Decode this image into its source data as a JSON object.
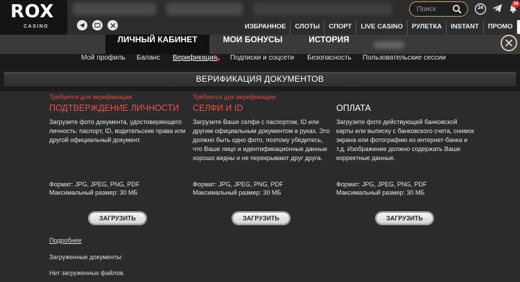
{
  "brand": {
    "logo": "ROX",
    "subtitle": "CASINO"
  },
  "header": {
    "top_nav": [
      "ИЗБРАННОЕ",
      "СЛОТЫ",
      "СПОРТ",
      "LIVE CASINO",
      "РУЛЕТКА",
      "INSTANT",
      "ПРОМО"
    ],
    "search_placeholder": "Поиск",
    "support_label": "24",
    "notification_count": "36",
    "social_icons": [
      "telegram-icon",
      "vk-icon",
      "x-icon"
    ]
  },
  "tabs": [
    "ЛИЧНЫЙ КАБИНЕТ",
    "МОИ БОНУСЫ",
    "ИСТОРИЯ"
  ],
  "subnav": [
    "Мой профиль",
    "Баланс",
    "Верификация",
    "Подписки и соцсети",
    "Безопасность",
    "Пользовательские сессии"
  ],
  "page_title": "ВЕРИФИКАЦИЯ ДОКУМЕНТОВ",
  "columns": [
    {
      "required": "Требуется для верификации",
      "title": "ПОДТВЕРЖДЕНИЕ ЛИЧНОСТИ",
      "description": "Загрузите фото документа, удостоверяющего личность: паспорт, ID, водительские права или другой официальный документ.",
      "format": "Формат: JPG, JPEG, PNG, PDF",
      "max_size": "Максимальный размер: 30 МБ",
      "button": "ЗАГРУЗИТЬ"
    },
    {
      "required": "Требуется для верификации",
      "title": "СЕЛФИ И ID",
      "description": "Загрузите Ваше селфи с паспортом, ID или другим официальным документом в руках. Это должно быть одно фото, поэтому убедитесь, что Ваше лицо и идентификационные данные хорошо видны и не перекрывают друг друга.",
      "format": "Формат: JPG, JPEG, PNG, PDF",
      "max_size": "Максимальный размер: 30 МБ",
      "button": "ЗАГРУЗИТЬ"
    },
    {
      "required": "",
      "title": "ОПЛАТА",
      "description": "Загрузите фото действующей банковской карты или выписку с банковского счета, снимок экрана или фотографию из интернет-банка и т.д. Изображение должно содержать Ваши корректные данные.",
      "format": "Формат: JPG, JPEG, PNG, PDF",
      "max_size": "Максимальный размер: 30 МБ",
      "button": "ЗАГРУЗИТЬ"
    }
  ],
  "more_link": "Подробнее",
  "uploaded_label": "Загруженные документы:",
  "no_files": "Нет загруженных файлов.",
  "colors": {
    "accent_gold": "#c8a56a",
    "required_red": "#e8483d",
    "notification_red": "#e02b2b"
  }
}
